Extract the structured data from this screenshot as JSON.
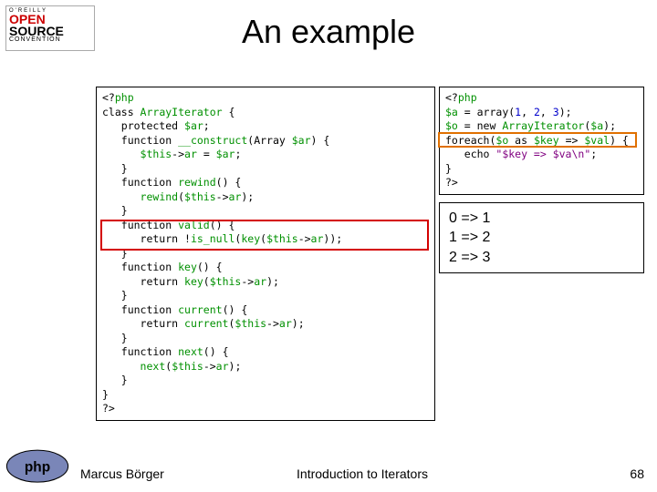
{
  "logo": {
    "line1": "O'REILLY",
    "line2": "OPEN",
    "line3": "SOURCE",
    "line4": "CONVENTION"
  },
  "title": "An example",
  "code_left": {
    "l1a": "<?",
    "l1b": "php",
    "l2a": "class ",
    "l2b": "ArrayIterator ",
    "l2c": "{",
    "l3a": "   protected ",
    "l3b": "$ar",
    "l3c": ";",
    "l4a": "   function ",
    "l4b": "__construct",
    "l4c": "(Array ",
    "l4d": "$ar",
    "l4e": ") {",
    "l5a": "      ",
    "l5b": "$this",
    "l5c": "->",
    "l5d": "ar ",
    "l5e": "= ",
    "l5f": "$ar",
    "l5g": ";",
    "l6": "   }",
    "l7a": "   function ",
    "l7b": "rewind",
    "l7c": "() {",
    "l8a": "      ",
    "l8b": "rewind",
    "l8c": "(",
    "l8d": "$this",
    "l8e": "->",
    "l8f": "ar",
    "l8g": ");",
    "l9": "   }",
    "l10a": "   function ",
    "l10b": "valid",
    "l10c": "() {",
    "l11a": "      return !",
    "l11b": "is_null",
    "l11c": "(",
    "l11d": "key",
    "l11e": "(",
    "l11f": "$this",
    "l11g": "->",
    "l11h": "ar",
    "l11i": "));",
    "l12": "   }",
    "l13a": "   function ",
    "l13b": "key",
    "l13c": "() {",
    "l14a": "      return ",
    "l14b": "key",
    "l14c": "(",
    "l14d": "$this",
    "l14e": "->",
    "l14f": "ar",
    "l14g": ");",
    "l15": "   }",
    "l16a": "   function ",
    "l16b": "current",
    "l16c": "() {",
    "l17a": "      return ",
    "l17b": "current",
    "l17c": "(",
    "l17d": "$this",
    "l17e": "->",
    "l17f": "ar",
    "l17g": ");",
    "l18": "   }",
    "l19a": "   function ",
    "l19b": "next",
    "l19c": "() {",
    "l20a": "      ",
    "l20b": "next",
    "l20c": "(",
    "l20d": "$this",
    "l20e": "->",
    "l20f": "ar",
    "l20g": ");",
    "l21": "   }",
    "l22": "}",
    "l23": "?>"
  },
  "code_right": {
    "r1a": "<?",
    "r1b": "php",
    "r2a": "$a ",
    "r2b": "= array(",
    "r2c": "1",
    "r2d": ", ",
    "r2e": "2",
    "r2f": ", ",
    "r2g": "3",
    "r2h": ");",
    "r3a": "$o ",
    "r3b": "= new ",
    "r3c": "ArrayIterator",
    "r3d": "(",
    "r3e": "$a",
    "r3f": ");",
    "r4a": "foreach(",
    "r4b": "$o ",
    "r4c": "as ",
    "r4d": "$key ",
    "r4e": "=> ",
    "r4f": "$val",
    "r4g": ") {",
    "r5a": "   echo ",
    "r5b": "\"$key => $va\\n\"",
    "r5c": ";",
    "r6": "}",
    "r7": "?>"
  },
  "output": "0 => 1\n1 => 2\n2 => 3",
  "footer": {
    "left": "Marcus Börger",
    "center": "Introduction to Iterators",
    "right": "68"
  }
}
